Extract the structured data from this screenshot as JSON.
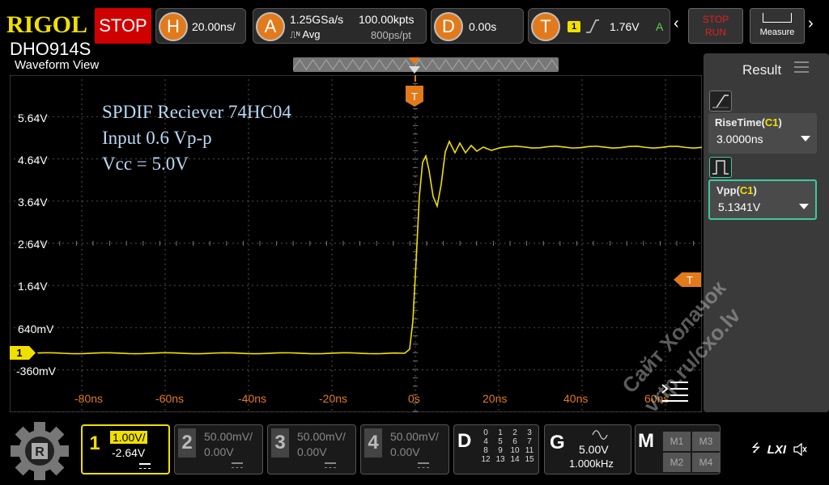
{
  "brand": {
    "logo": "RIGOL",
    "model": "DHO914S"
  },
  "run_state": "STOP",
  "horizontal": {
    "letter": "H",
    "timebase": "20.00ns/"
  },
  "acquire": {
    "letter": "A",
    "sample_rate": "1.25GSa/s",
    "mode": "Avg",
    "memory": "100.00kpts",
    "resolution": "800ps/pt"
  },
  "delay": {
    "letter": "D",
    "value": "0.00s"
  },
  "trigger": {
    "letter": "T",
    "source": "1",
    "level": "1.76V",
    "mode": "A"
  },
  "controls": {
    "run_stop_line1": "STOP",
    "run_stop_line2": "RUN",
    "measure_label": "Measure"
  },
  "waveform_view": {
    "title": "Waveform View",
    "annotation": [
      "SPDIF Reciever 74HC04",
      "Input 0.6 Vp-p",
      "Vcc = 5.0V"
    ],
    "y_labels": [
      "5.64V",
      "4.64V",
      "3.64V",
      "2.64V",
      "1.64V",
      "640mV",
      "-360mV"
    ],
    "x_labels": [
      "-80ns",
      "-60ns",
      "-40ns",
      "-20ns",
      "0s",
      "20ns",
      "40ns",
      "60ns"
    ],
    "trigger_marker": "T",
    "trigger_level_marker": "T",
    "channel_marker": "1"
  },
  "result_panel": {
    "title": "Result",
    "measurements": [
      {
        "name": "RiseTime",
        "channel": "C1",
        "value": "3.0000ns"
      },
      {
        "name": "Vpp",
        "channel": "C1",
        "value": "5.1341V"
      }
    ]
  },
  "channels": [
    {
      "num": "1",
      "scale": "1.00V/",
      "offset": "-2.64V",
      "active": true
    },
    {
      "num": "2",
      "scale": "50.00mV/",
      "offset": "0.00V",
      "active": false
    },
    {
      "num": "3",
      "scale": "50.00mV/",
      "offset": "0.00V",
      "active": false
    },
    {
      "num": "4",
      "scale": "50.00mV/",
      "offset": "0.00V",
      "active": false
    }
  ],
  "digital": {
    "letter": "D",
    "bits": [
      "0",
      "1",
      "2",
      "3",
      "4",
      "5",
      "6",
      "7",
      "8",
      "9",
      "10",
      "11",
      "12",
      "13",
      "14",
      "15"
    ]
  },
  "generator": {
    "letter": "G",
    "amplitude": "5.00V",
    "frequency": "1.000kHz"
  },
  "math": {
    "letter": "M",
    "slots": [
      "M1",
      "M3",
      "M2",
      "M4"
    ]
  },
  "status": {
    "lxi": "LXI"
  },
  "watermark": "Сайт Холачок\nvrtp.ru/cxo.lv",
  "colors": {
    "ch1": "#f0e000",
    "accent": "#e27a1c",
    "stop": "#d10000",
    "annotation": "#b9d8f2"
  }
}
